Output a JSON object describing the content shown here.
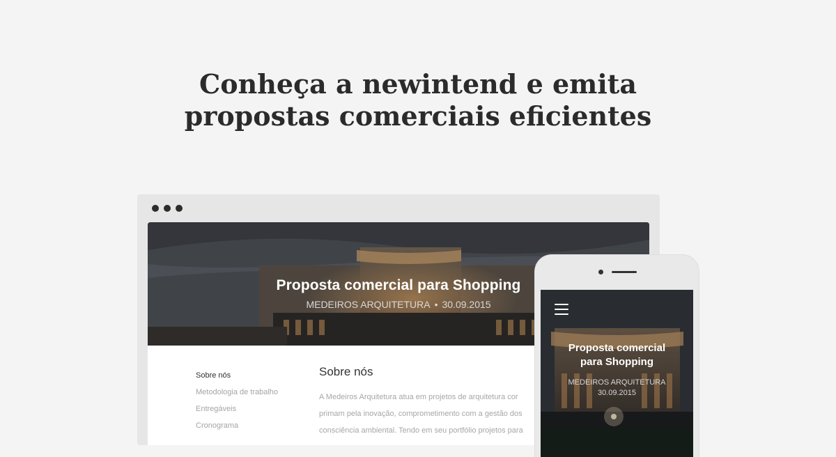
{
  "headline": {
    "line1": "Conheça a newintend e emita",
    "line2": "propostas comerciais eficientes"
  },
  "desktop": {
    "hero": {
      "title": "Proposta comercial para Shopping",
      "company": "MEDEIROS ARQUITETURA",
      "separator": "•",
      "date": "30.09.2015"
    },
    "nav": [
      {
        "label": "Sobre nós"
      },
      {
        "label": "Metodologia de trabalho"
      },
      {
        "label": "Entregáveis"
      },
      {
        "label": "Cronograma"
      }
    ],
    "section": {
      "title": "Sobre nós",
      "lines": [
        "A Medeiros Arquitetura atua em projetos de arquitetura cor",
        "primam pela inovação, comprometimento com a gestão dos",
        "consciência ambiental. Tendo em seu portfólio projetos para"
      ]
    }
  },
  "mobile": {
    "menu_icon": "hamburger-icon",
    "title_line1": "Proposta comercial",
    "title_line2": "para Shopping",
    "company": "MEDEIROS ARQUITETURA",
    "date": "30.09.2015"
  }
}
